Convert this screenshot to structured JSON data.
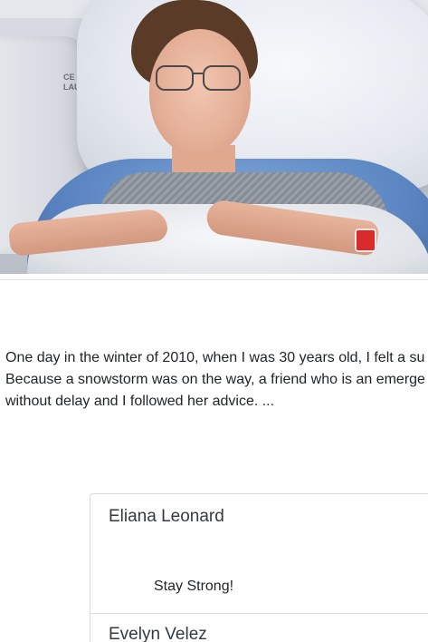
{
  "hero_image": {
    "alt_subject": "Patient resting in hospital bed",
    "rail_text": [
      "CE",
      "LAU"
    ]
  },
  "story": {
    "lines": [
      "One day in the winter of 2010, when I was 30 years old, I felt a su",
      "Because a snowstorm was on the way, a friend who is an emerge",
      "without delay and I followed her advice. ..."
    ]
  },
  "comments": [
    {
      "name": "Eliana Leonard",
      "message": "Stay Strong!"
    },
    {
      "name": "Evelyn Velez",
      "message": ""
    }
  ],
  "colors": {
    "text": "#212529",
    "name_text": "#343a40",
    "border": "#d9dcdf",
    "wristband": "#d92b2b",
    "gown": "#5c86c2"
  }
}
